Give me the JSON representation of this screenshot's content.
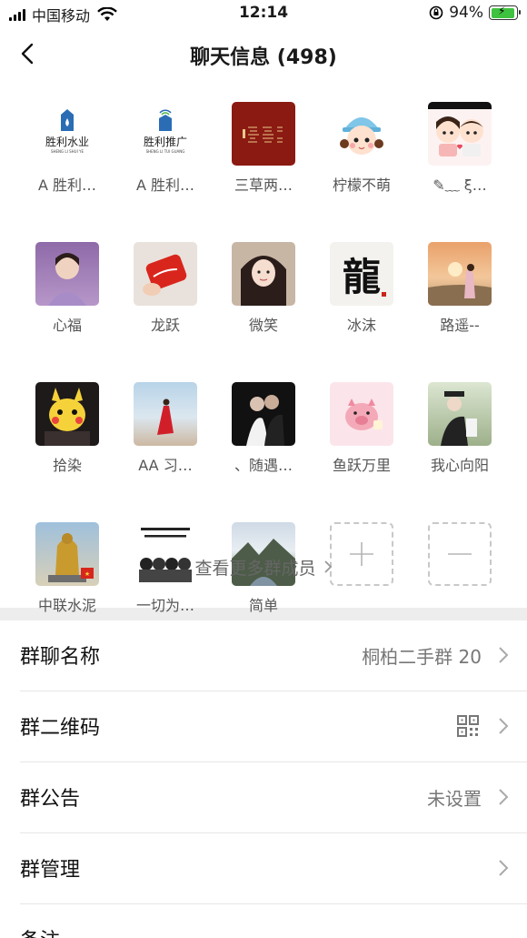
{
  "status_bar": {
    "carrier": "中国移动",
    "time": "12:14",
    "battery_percent": "94%",
    "battery_level": 0.94,
    "battery_color": "#3fc23f"
  },
  "nav": {
    "title": "聊天信息 (498)",
    "back_icon": "chevron-left-icon"
  },
  "members": [
    {
      "name": "A 胜利…",
      "avatar_text": "胜利水业",
      "avatar_sub": "SHENG LI SHUI YE"
    },
    {
      "name": "A 胜利…",
      "avatar_text": "胜利推广",
      "avatar_sub": "SHENG LI TUI GUANG"
    },
    {
      "name": "三草两…"
    },
    {
      "name": "柠檬不萌"
    },
    {
      "name": "✎﹏ ξ…"
    },
    {
      "name": "心福"
    },
    {
      "name": "龙跃"
    },
    {
      "name": "微笑"
    },
    {
      "name": "冰沫",
      "avatar_text": "龍"
    },
    {
      "name": "路遥--"
    },
    {
      "name": "拾染"
    },
    {
      "name": "AA 习…"
    },
    {
      "name": "、随遇…"
    },
    {
      "name": "鱼跃万里"
    },
    {
      "name": "我心向阳"
    },
    {
      "name": "中联水泥"
    },
    {
      "name": "一切为…"
    },
    {
      "name": "简单"
    }
  ],
  "member_actions": {
    "add_icon": "plus-icon",
    "remove_icon": "minus-icon"
  },
  "view_more": "查看更多群成员",
  "settings": {
    "group_name": {
      "label": "群聊名称",
      "value": "桐柏二手群 20"
    },
    "qr_code": {
      "label": "群二维码",
      "icon": "qr-code-icon"
    },
    "announcement": {
      "label": "群公告",
      "value": "未设置"
    },
    "manage": {
      "label": "群管理"
    },
    "remark": {
      "label": "备注"
    }
  }
}
